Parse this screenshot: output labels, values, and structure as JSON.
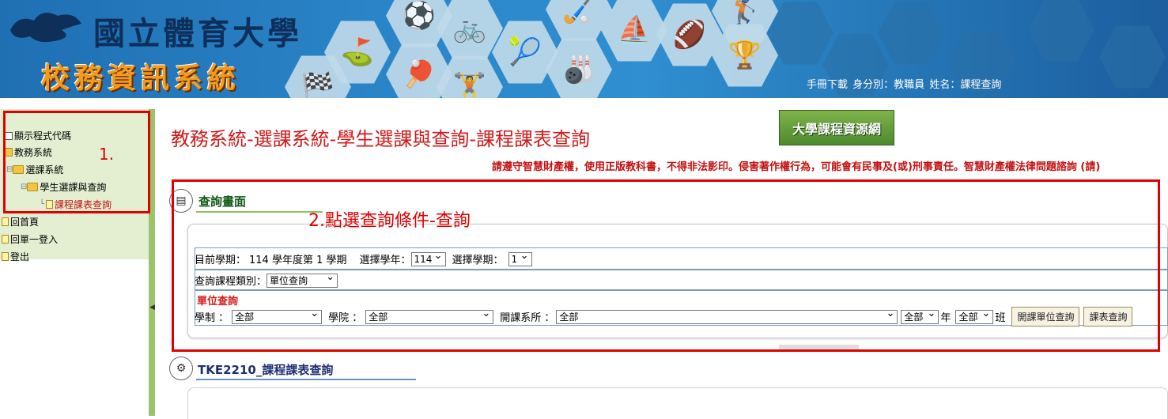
{
  "banner": {
    "university": "國立體育大學",
    "system": "校務資訊系統",
    "links": [
      "手冊下載",
      "身分別：教職員",
      "姓名：課程查詢"
    ],
    "colors": {
      "bg": "#2b86c9",
      "accent": "#f29b1c"
    }
  },
  "sidebar": {
    "items": [
      {
        "label": "顯示程式代碼",
        "icon": "checkbox-icon"
      },
      {
        "label": "教務系統",
        "icon": "folder-icon"
      },
      {
        "label": "選課系統",
        "icon": "folder-icon"
      },
      {
        "label": "學生選課與查詢",
        "icon": "folder-icon"
      },
      {
        "label": "課程課表查詢",
        "icon": "page-icon"
      },
      {
        "label": "回首頁",
        "icon": "page-icon"
      },
      {
        "label": "回單一登入",
        "icon": "page-icon"
      },
      {
        "label": "登出",
        "icon": "page-icon"
      }
    ],
    "annotation": "1."
  },
  "main": {
    "title": "教務系統-選課系統-學生選課與查詢-課程課表查詢",
    "ad_label": "大學課程資源網",
    "notice": "請遵守智慧財產權，使用正版教科書，不得非法影印。侵害著作權行為，可能會有民事及(或)刑事責任。智慧財產權法律問題諮詢 (請)",
    "query_section": {
      "title": "查詢畫面",
      "annotation": "2.點選查詢條件-查詢",
      "current_term_label": "目前學期：",
      "current_term_value": "114 學年度第 1 學期",
      "year_label": "選擇學年：",
      "year_value": "114",
      "sem_label": "選擇學期：",
      "sem_value": "1",
      "type_label": "查詢課程類別：",
      "type_value": "單位查詢",
      "unit_title": "單位查詢",
      "system_label": "學制 ：",
      "system_value": "全部",
      "college_label": "學院 ：",
      "college_value": "全部",
      "dept_label": "開課系所 ：",
      "dept_value": "全部",
      "grade_value": "全部",
      "grade_suffix": "年",
      "class_value": "全部",
      "class_suffix": "班",
      "unit_query_btn": "開課單位查詢",
      "timetable_btn": "課表查詢"
    },
    "result_section": {
      "title": "TKE2210_課程課表查詢"
    }
  }
}
